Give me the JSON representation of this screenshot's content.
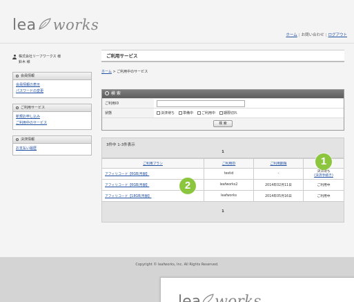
{
  "header": {
    "logo_left": "lea",
    "logo_right": "works",
    "links": [
      "ホーム",
      "お問い合わせ",
      "ログアウト"
    ]
  },
  "sidebar": {
    "user_name_line1": "株式会社リーフワークス 様",
    "user_name_line2": "鈴木 様",
    "sections": [
      {
        "title": "会員情報",
        "links": [
          "会員情報の表示",
          "パスワードの変更"
        ]
      },
      {
        "title": "ご利用サービス",
        "links": [
          "新規お申し込み",
          "ご利用中のサービス"
        ]
      },
      {
        "title": "決済情報",
        "links": [
          "お支払い履歴"
        ]
      }
    ]
  },
  "main": {
    "page_title": "ご利用サービス",
    "breadcrumb_home": "ホーム",
    "breadcrumb_sep": " > ",
    "breadcrumb_current": "ご利用中のサービス",
    "search": {
      "title": "検 索",
      "id_label": "ご利用ID",
      "status_label": "状態",
      "status_options": [
        "決済待ち",
        "準備中",
        "ご利用中",
        "期限切れ"
      ],
      "button": "検 索"
    },
    "results": {
      "count_text": "3件中 1-3件表示",
      "page": "1",
      "columns": [
        "ご利用プラン",
        "ご利用ID",
        "ご利用期限",
        "状態"
      ],
      "rows": [
        {
          "plan": "アフィリコード【6GB/月額】",
          "id": "testid",
          "expiry": "-",
          "status_line1": "決済待ち",
          "status_line2": "(決済手続き)"
        },
        {
          "plan": "アフィリコード【6GB/月額】",
          "id": "leafworks2",
          "expiry": "2014年02月11日",
          "status_line1": "ご利用中",
          "status_line2": ""
        },
        {
          "plan": "アフィリコード【18GB/月額】",
          "id": "leafworks",
          "expiry": "2014年05月16日",
          "status_line1": "ご利用中",
          "status_line2": ""
        }
      ]
    }
  },
  "footer": {
    "copyright": "Copyright © leafworks, Inc. All Rights Reserved."
  },
  "callouts": [
    "1",
    "2"
  ],
  "colors": {
    "callout": "#8cc63f",
    "link": "#1f4fa3"
  }
}
